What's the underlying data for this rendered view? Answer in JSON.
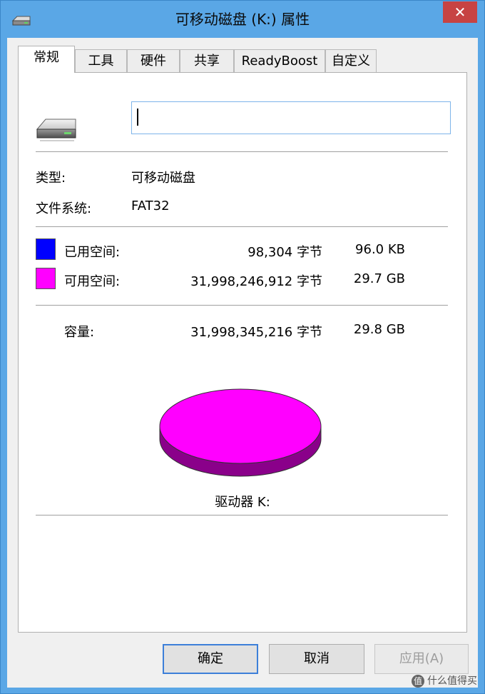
{
  "window": {
    "title": "可移动磁盘 (K:) 属性",
    "close_glyph": "✕"
  },
  "tabs": [
    {
      "label": "常规",
      "active": true
    },
    {
      "label": "工具",
      "active": false
    },
    {
      "label": "硬件",
      "active": false
    },
    {
      "label": "共享",
      "active": false
    },
    {
      "label": "ReadyBoost",
      "active": false
    },
    {
      "label": "自定义",
      "active": false
    }
  ],
  "general": {
    "volume_label_value": "",
    "type_label": "类型:",
    "type_value": "可移动磁盘",
    "fs_label": "文件系统:",
    "fs_value": "FAT32",
    "used_label": "已用空间:",
    "used_bytes": "98,304 字节",
    "used_size": "96.0 KB",
    "free_label": "可用空间:",
    "free_bytes": "31,998,246,912 字节",
    "free_size": "29.7 GB",
    "capacity_label": "容量:",
    "capacity_bytes": "31,998,345,216 字节",
    "capacity_size": "29.8 GB",
    "drive_caption": "驱动器 K:",
    "used_color": "#0000ff",
    "free_color": "#ff00ff",
    "used_fraction": 3.1e-06
  },
  "buttons": {
    "ok": "确定",
    "cancel": "取消",
    "apply": "应用(A)"
  },
  "watermark": {
    "badge": "值",
    "text": "什么值得买"
  },
  "icons": {
    "title": "removable-drive-icon",
    "drive": "removable-drive-icon",
    "close": "close-icon"
  }
}
